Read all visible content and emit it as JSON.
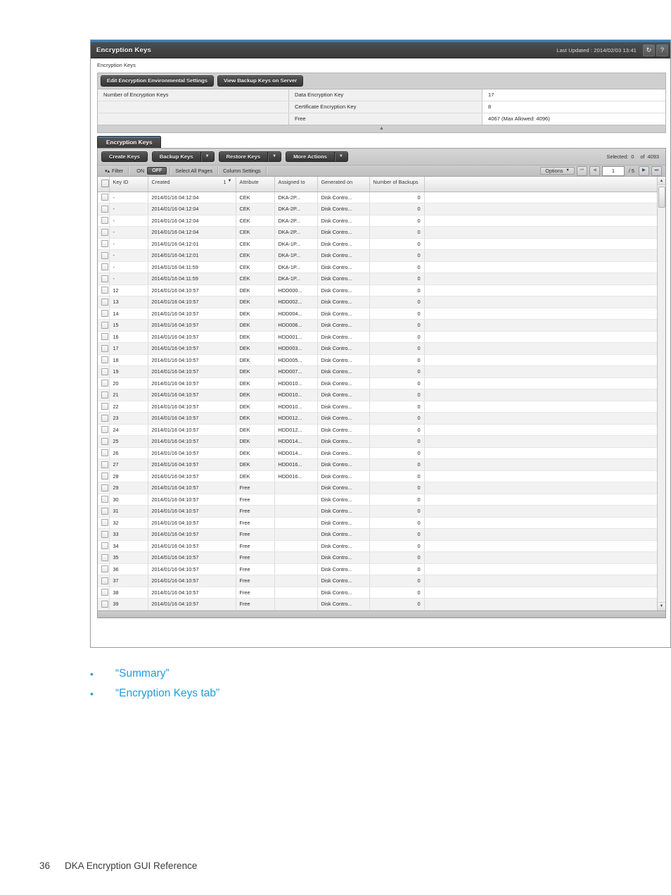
{
  "window": {
    "title": "Encryption Keys",
    "last_updated_label": "Last Updated : 2014/02/03 13:41",
    "refresh_icon": "refresh-icon",
    "help_icon": "help-icon",
    "breadcrumb": "Encryption Keys"
  },
  "summary": {
    "buttons": [
      {
        "label": "Edit Encryption Environmental Settings",
        "name": "edit-encryption-environmental-settings-button"
      },
      {
        "label": "View Backup Keys on Server",
        "name": "view-backup-keys-on-server-button"
      }
    ],
    "group_label": "Number of Encryption Keys",
    "rows": [
      {
        "key": "Data Encryption Key",
        "value": "17"
      },
      {
        "key": "Certificate Encryption Key",
        "value": "8"
      },
      {
        "key": "Free",
        "value": "4067 (Max Allowed: 4096)"
      }
    ],
    "collapse_icon": "chevron-up-icon"
  },
  "tab": {
    "label": "Encryption Keys"
  },
  "toolbar": {
    "buttons": [
      {
        "label": "Create Keys",
        "name": "create-keys-button",
        "split": false
      },
      {
        "label": "Backup Keys",
        "name": "backup-keys-button",
        "split": true
      },
      {
        "label": "Restore Keys",
        "name": "restore-keys-button",
        "split": true
      },
      {
        "label": "More Actions",
        "name": "more-actions-button",
        "split": true
      }
    ],
    "selected_label": "Selected:",
    "selected_count": "0",
    "of_label": "of",
    "total_count": "4093"
  },
  "filterbar": {
    "filter_label": "Filter",
    "filter_icon": "filter-icon",
    "toggle_on": "ON",
    "toggle_off": "OFF",
    "select_all_pages": "Select All Pages",
    "column_settings": "Column Settings",
    "options_label": "Options",
    "options_caret": "chevron-down-icon",
    "first_page_icon": "first-page-icon",
    "prev_page_icon": "prev-page-icon",
    "page_value": "1",
    "page_total": "/ 5",
    "next_page_icon": "next-page-icon",
    "last_page_icon": "last-page-icon"
  },
  "grid": {
    "columns": [
      {
        "label": "",
        "name": "select-all-checkbox-column"
      },
      {
        "label": "Key ID",
        "name": "column-key-id"
      },
      {
        "label": "Created",
        "name": "column-created",
        "sort_order": "1",
        "sort_dir": "descending"
      },
      {
        "label": "Attribute",
        "name": "column-attribute"
      },
      {
        "label": "Assigned to",
        "name": "column-assigned-to"
      },
      {
        "label": "Generated on",
        "name": "column-generated-on"
      },
      {
        "label": "Number of Backups",
        "name": "column-number-of-backups"
      },
      {
        "label": "",
        "name": "column-filler"
      }
    ],
    "rows": [
      {
        "key_id": "-",
        "created": "2014/01/16 04:12:04",
        "attribute": "CEK",
        "assigned_to": "DKA-2P...",
        "generated_on": "Disk Contro...",
        "backups": "0"
      },
      {
        "key_id": "-",
        "created": "2014/01/16 04:12:04",
        "attribute": "CEK",
        "assigned_to": "DKA-2P...",
        "generated_on": "Disk Contro...",
        "backups": "0"
      },
      {
        "key_id": "-",
        "created": "2014/01/16 04:12:04",
        "attribute": "CEK",
        "assigned_to": "DKA-2P...",
        "generated_on": "Disk Contro...",
        "backups": "0"
      },
      {
        "key_id": "-",
        "created": "2014/01/16 04:12:04",
        "attribute": "CEK",
        "assigned_to": "DKA-2P...",
        "generated_on": "Disk Contro...",
        "backups": "0"
      },
      {
        "key_id": "-",
        "created": "2014/01/16 04:12:01",
        "attribute": "CEK",
        "assigned_to": "DKA-1P...",
        "generated_on": "Disk Contro...",
        "backups": "0"
      },
      {
        "key_id": "-",
        "created": "2014/01/16 04:12:01",
        "attribute": "CEK",
        "assigned_to": "DKA-1P...",
        "generated_on": "Disk Contro...",
        "backups": "0"
      },
      {
        "key_id": "-",
        "created": "2014/01/16 04:11:59",
        "attribute": "CEK",
        "assigned_to": "DKA-1P...",
        "generated_on": "Disk Contro...",
        "backups": "0"
      },
      {
        "key_id": "-",
        "created": "2014/01/16 04:11:59",
        "attribute": "CEK",
        "assigned_to": "DKA-1P...",
        "generated_on": "Disk Contro...",
        "backups": "0"
      },
      {
        "key_id": "12",
        "created": "2014/01/16 04:10:57",
        "attribute": "DEK",
        "assigned_to": "HDD000...",
        "generated_on": "Disk Contro...",
        "backups": "0"
      },
      {
        "key_id": "13",
        "created": "2014/01/16 04:10:57",
        "attribute": "DEK",
        "assigned_to": "HDD002...",
        "generated_on": "Disk Contro...",
        "backups": "0"
      },
      {
        "key_id": "14",
        "created": "2014/01/16 04:10:57",
        "attribute": "DEK",
        "assigned_to": "HDD004...",
        "generated_on": "Disk Contro...",
        "backups": "0"
      },
      {
        "key_id": "15",
        "created": "2014/01/16 04:10:57",
        "attribute": "DEK",
        "assigned_to": "HDD006...",
        "generated_on": "Disk Contro...",
        "backups": "0"
      },
      {
        "key_id": "16",
        "created": "2014/01/16 04:10:57",
        "attribute": "DEK",
        "assigned_to": "HDD001...",
        "generated_on": "Disk Contro...",
        "backups": "0"
      },
      {
        "key_id": "17",
        "created": "2014/01/16 04:10:57",
        "attribute": "DEK",
        "assigned_to": "HDD003...",
        "generated_on": "Disk Contro...",
        "backups": "0"
      },
      {
        "key_id": "18",
        "created": "2014/01/16 04:10:57",
        "attribute": "DEK",
        "assigned_to": "HDD005...",
        "generated_on": "Disk Contro...",
        "backups": "0"
      },
      {
        "key_id": "19",
        "created": "2014/01/16 04:10:57",
        "attribute": "DEK",
        "assigned_to": "HDD007...",
        "generated_on": "Disk Contro...",
        "backups": "0"
      },
      {
        "key_id": "20",
        "created": "2014/01/16 04:10:57",
        "attribute": "DEK",
        "assigned_to": "HDD010...",
        "generated_on": "Disk Contro...",
        "backups": "0"
      },
      {
        "key_id": "21",
        "created": "2014/01/16 04:10:57",
        "attribute": "DEK",
        "assigned_to": "HDD010...",
        "generated_on": "Disk Contro...",
        "backups": "0"
      },
      {
        "key_id": "22",
        "created": "2014/01/16 04:10:57",
        "attribute": "DEK",
        "assigned_to": "HDD010...",
        "generated_on": "Disk Contro...",
        "backups": "0"
      },
      {
        "key_id": "23",
        "created": "2014/01/16 04:10:57",
        "attribute": "DEK",
        "assigned_to": "HDD012...",
        "generated_on": "Disk Contro...",
        "backups": "0"
      },
      {
        "key_id": "24",
        "created": "2014/01/16 04:10:57",
        "attribute": "DEK",
        "assigned_to": "HDD012...",
        "generated_on": "Disk Contro...",
        "backups": "0"
      },
      {
        "key_id": "25",
        "created": "2014/01/16 04:10:57",
        "attribute": "DEK",
        "assigned_to": "HDD014...",
        "generated_on": "Disk Contro...",
        "backups": "0"
      },
      {
        "key_id": "26",
        "created": "2014/01/16 04:10:57",
        "attribute": "DEK",
        "assigned_to": "HDD014...",
        "generated_on": "Disk Contro...",
        "backups": "0"
      },
      {
        "key_id": "27",
        "created": "2014/01/16 04:10:57",
        "attribute": "DEK",
        "assigned_to": "HDD016...",
        "generated_on": "Disk Contro...",
        "backups": "0"
      },
      {
        "key_id": "28",
        "created": "2014/01/16 04:10:57",
        "attribute": "DEK",
        "assigned_to": "HDD016...",
        "generated_on": "Disk Contro...",
        "backups": "0"
      },
      {
        "key_id": "29",
        "created": "2014/01/16 04:10:57",
        "attribute": "Free",
        "assigned_to": "",
        "generated_on": "Disk Contro...",
        "backups": "0"
      },
      {
        "key_id": "30",
        "created": "2014/01/16 04:10:57",
        "attribute": "Free",
        "assigned_to": "",
        "generated_on": "Disk Contro...",
        "backups": "0"
      },
      {
        "key_id": "31",
        "created": "2014/01/16 04:10:57",
        "attribute": "Free",
        "assigned_to": "",
        "generated_on": "Disk Contro...",
        "backups": "0"
      },
      {
        "key_id": "32",
        "created": "2014/01/16 04:10:57",
        "attribute": "Free",
        "assigned_to": "",
        "generated_on": "Disk Contro...",
        "backups": "0"
      },
      {
        "key_id": "33",
        "created": "2014/01/16 04:10:57",
        "attribute": "Free",
        "assigned_to": "",
        "generated_on": "Disk Contro...",
        "backups": "0"
      },
      {
        "key_id": "34",
        "created": "2014/01/16 04:10:57",
        "attribute": "Free",
        "assigned_to": "",
        "generated_on": "Disk Contro...",
        "backups": "0"
      },
      {
        "key_id": "35",
        "created": "2014/01/16 04:10:57",
        "attribute": "Free",
        "assigned_to": "",
        "generated_on": "Disk Contro...",
        "backups": "0"
      },
      {
        "key_id": "36",
        "created": "2014/01/16 04:10:57",
        "attribute": "Free",
        "assigned_to": "",
        "generated_on": "Disk Contro...",
        "backups": "0"
      },
      {
        "key_id": "37",
        "created": "2014/01/16 04:10:57",
        "attribute": "Free",
        "assigned_to": "",
        "generated_on": "Disk Contro...",
        "backups": "0"
      },
      {
        "key_id": "38",
        "created": "2014/01/16 04:10:57",
        "attribute": "Free",
        "assigned_to": "",
        "generated_on": "Disk Contro...",
        "backups": "0"
      },
      {
        "key_id": "39",
        "created": "2014/01/16 04:10:57",
        "attribute": "Free",
        "assigned_to": "",
        "generated_on": "Disk Contro...",
        "backups": "0"
      }
    ]
  },
  "document": {
    "bullets": [
      "“Summary”",
      "“Encryption Keys tab”"
    ],
    "page_number": "36",
    "footer_title": "DKA Encryption GUI Reference"
  },
  "colors": {
    "accent_blue": "#2e7fc4",
    "link_blue": "#1b9fe0",
    "titlebar_dark": "#3a3a3a"
  }
}
